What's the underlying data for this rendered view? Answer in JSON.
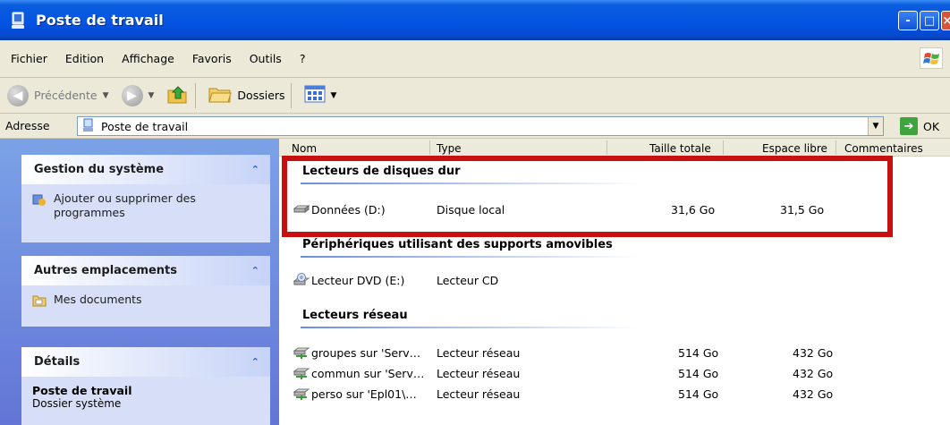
{
  "window": {
    "title": "Poste de travail",
    "buttons": [
      "-",
      "□",
      "×"
    ]
  },
  "menu": {
    "items": [
      {
        "label": "Fichier"
      },
      {
        "label": "Edition"
      },
      {
        "label": "Affichage"
      },
      {
        "label": "Favoris"
      },
      {
        "label": "Outils"
      },
      {
        "label": "?"
      }
    ]
  },
  "toolbar": {
    "back_label": "Précédente",
    "folders_label": "Dossiers"
  },
  "address": {
    "label": "Adresse",
    "value": "Poste de travail",
    "go_label": "OK"
  },
  "tasks": {
    "system": {
      "title": "Gestion du système",
      "link": "Ajouter ou supprimer des programmes"
    },
    "places": {
      "title": "Autres emplacements",
      "link": "Mes documents"
    },
    "details": {
      "title": "Détails",
      "name": "Poste de travail",
      "desc": "Dossier système"
    }
  },
  "columns": [
    "Nom",
    "Type",
    "Taille totale",
    "Espace libre",
    "Commentaires"
  ],
  "groups": [
    {
      "title": "Lecteurs de disques dur",
      "rows": [
        {
          "name": "Données (D:)",
          "type": "Disque local",
          "total": "31,6 Go",
          "free": "31,5 Go"
        }
      ]
    },
    {
      "title": "Périphériques utilisant des supports amovibles",
      "rows": [
        {
          "name": "Lecteur DVD (E:)",
          "type": "Lecteur CD",
          "total": "",
          "free": ""
        }
      ]
    },
    {
      "title": "Lecteurs réseau",
      "rows": [
        {
          "name": "groupes sur 'Serv…",
          "type": "Lecteur réseau",
          "total": "514 Go",
          "free": "432 Go"
        },
        {
          "name": "commun sur 'Serv…",
          "type": "Lecteur réseau",
          "total": "514 Go",
          "free": "432 Go"
        },
        {
          "name": "perso sur 'Epl01\\…",
          "type": "Lecteur réseau",
          "total": "514 Go",
          "free": "432 Go"
        }
      ]
    }
  ],
  "colors": {
    "titlebar": "#0554e3",
    "highlight": "#c81010",
    "taskpane": "#6375d6"
  }
}
